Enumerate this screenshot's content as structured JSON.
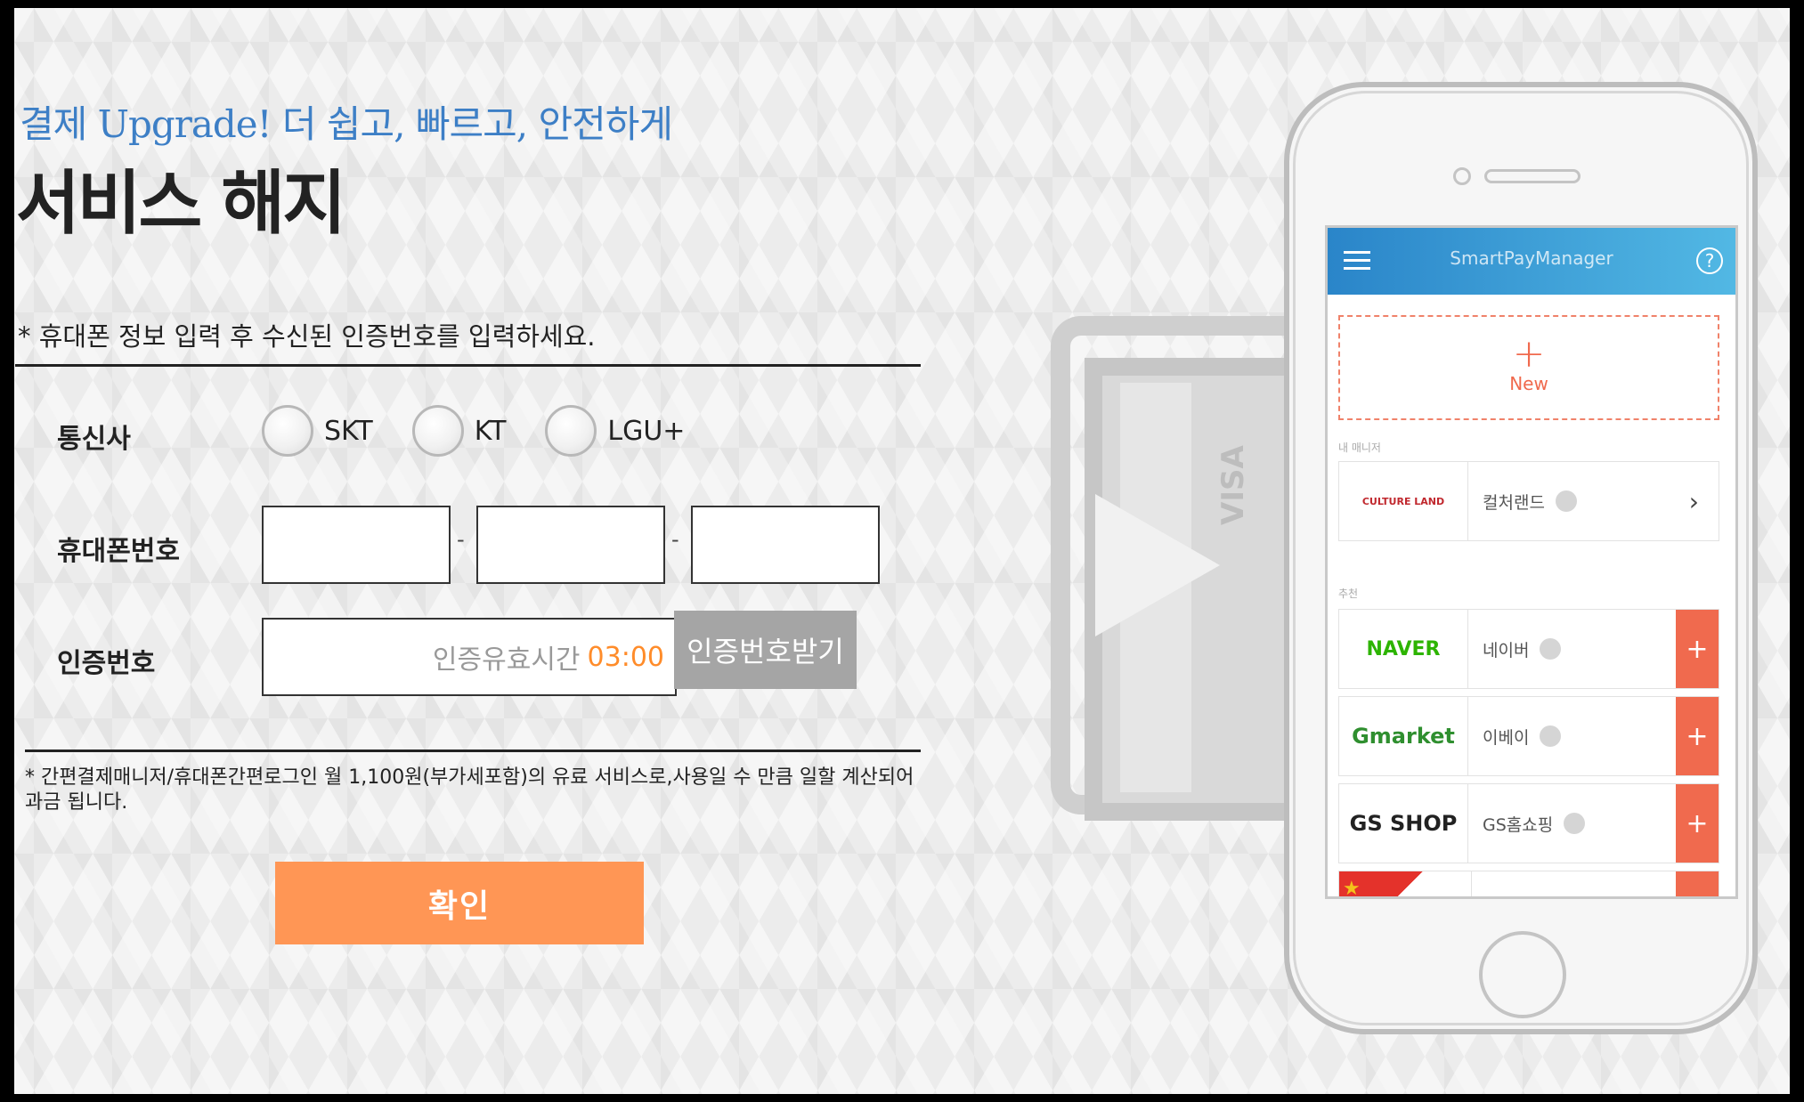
{
  "header": {
    "subtitle": "결제 Upgrade! 더 쉽고, 빠르고, 안전하게",
    "title": "서비스 해지"
  },
  "form": {
    "instruction": "* 휴대폰 정보 입력 후 수신된 인증번호를 입력하세요.",
    "carrier": {
      "label": "통신사",
      "options": [
        "SKT",
        "KT",
        "LGU+"
      ]
    },
    "phone": {
      "label": "휴대폰번호",
      "separator": "-",
      "fields": [
        "",
        "",
        ""
      ]
    },
    "auth": {
      "label": "인증번호",
      "timer_label": "인증유효시간",
      "timer_value": "03:00",
      "request_button": "인증번호받기"
    },
    "notice": "* 간편결제매니저/휴대폰간편로그인 월 1,100원(부가세포함)의 유료 서비스로,사용일 수 만큼 일할 계산되어 과금 됩니다.",
    "confirm_button": "확인"
  },
  "phone_mockup": {
    "card_brand": "VISA",
    "app_title": "SmartPayManager",
    "help_symbol": "?",
    "new_button": "New",
    "section_my": "내 매니저",
    "section_recommend": "추천",
    "my_items": [
      {
        "logo": "CULTURE LAND",
        "name": "컬처랜드",
        "icon": "chevron-right-icon"
      }
    ],
    "recommend_items": [
      {
        "logo": "NAVER",
        "name": "네이버",
        "logo_color": "#2db400"
      },
      {
        "logo": "Gmarket",
        "name": "이베이",
        "logo_color": "#2f8f2f"
      },
      {
        "logo": "GS SHOP",
        "name": "GS홈쇼핑",
        "logo_color": "#222222"
      }
    ],
    "accent_color": "#f06a4e"
  },
  "colors": {
    "subtitle": "#3d7fc6",
    "confirm_button": "#ff9655",
    "auth_button": "#a5a5a5",
    "timer": "#ff8c2a"
  }
}
